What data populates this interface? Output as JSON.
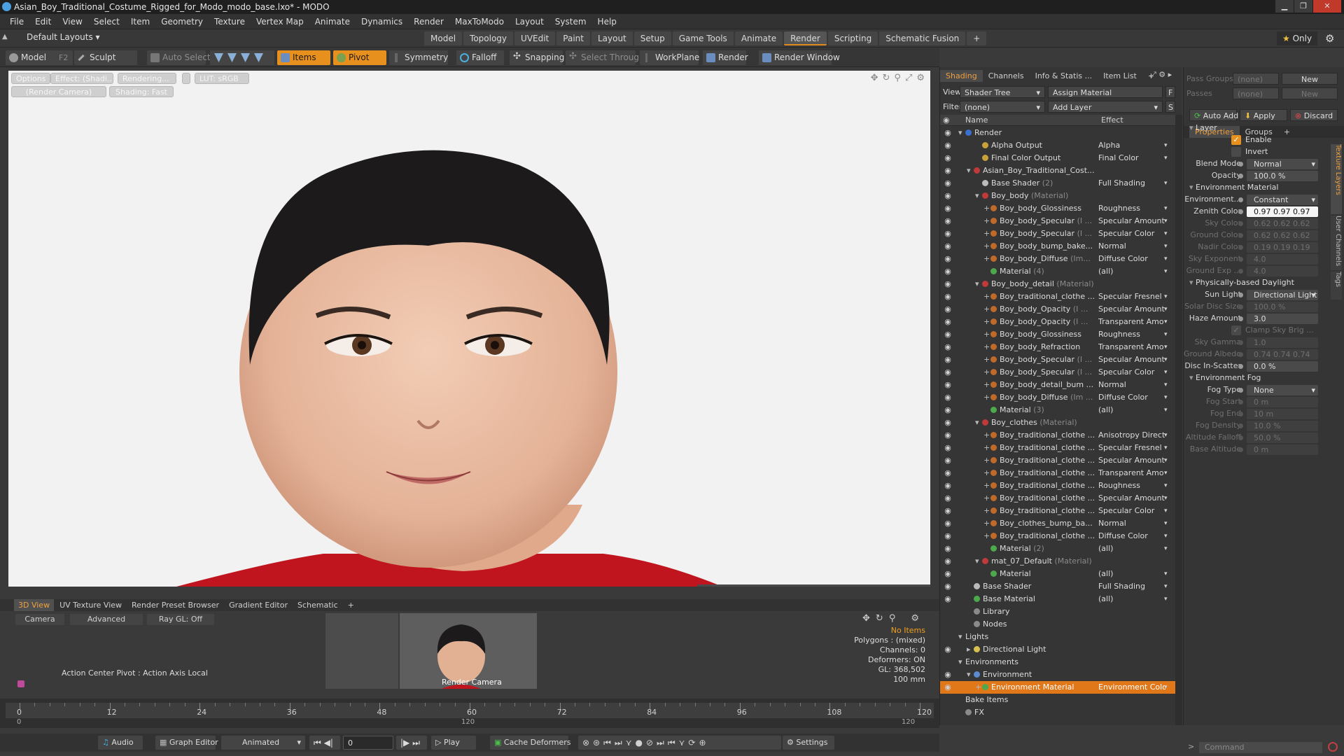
{
  "window": {
    "title": "Asian_Boy_Traditional_Costume_Rigged_for_Modo_modo_base.lxo* - MODO"
  },
  "menu": [
    "File",
    "Edit",
    "View",
    "Select",
    "Item",
    "Geometry",
    "Texture",
    "Vertex Map",
    "Animate",
    "Dynamics",
    "Render",
    "MaxToModo",
    "Layout",
    "System",
    "Help"
  ],
  "layout": {
    "selector": "Default Layouts ▾",
    "only": "Only",
    "tabs": [
      "Model",
      "Topology",
      "UVEdit",
      "Paint",
      "Layout",
      "Setup",
      "Game Tools",
      "Animate",
      "Render",
      "Scripting",
      "Schematic Fusion",
      "+"
    ],
    "active_tab": "Render"
  },
  "toolbar": {
    "model": "Model",
    "f2": "F2",
    "sculpt": "Sculpt",
    "auto_select": "Auto Select",
    "items": "Items",
    "pivot": "Pivot",
    "symmetry": "Symmetry",
    "falloff": "Falloff",
    "snapping": "Snapping",
    "select_through": "Select Through",
    "workplane": "WorkPlane",
    "render": "Render",
    "render_window": "Render Window"
  },
  "viewport": {
    "chips": [
      "Options",
      "Effect: (Shadi...",
      "Rendering...",
      "LUT: sRGB",
      "(Render Camera)",
      "Shading: Fast"
    ]
  },
  "bottom_tabs": [
    "3D View",
    "UV Texture View",
    "Render Preset Browser",
    "Gradient Editor",
    "Schematic",
    "+"
  ],
  "bottom": {
    "camera": "Camera",
    "advanced": "Advanced",
    "raygl": "Ray GL: Off",
    "action_center": "Action Center Pivot : Action Axis Local",
    "render_camera": "Render Camera",
    "status": [
      "No Items",
      "Polygons : (mixed)",
      "Channels: 0",
      "Deformers: ON",
      "GL: 368,502",
      "100 mm"
    ]
  },
  "timeline": {
    "ticks": [
      "0",
      "12",
      "24",
      "36",
      "48",
      "60",
      "72",
      "84",
      "96",
      "108",
      "120"
    ],
    "sub_ticks": [
      "0",
      "120"
    ]
  },
  "playbar": {
    "audio": "Audio",
    "graph_editor": "Graph Editor",
    "animated": "Animated",
    "frame": "0",
    "play": "Play",
    "cache": "Cache Deformers",
    "settings": "Settings"
  },
  "shading": {
    "tabs": [
      "Shading",
      "Channels",
      "Info & Statis ...",
      "Item List",
      "+"
    ],
    "view_label": "View",
    "view_value": "Shader Tree",
    "assign": "Assign Material",
    "f_btn": "F",
    "filter_label": "Filter",
    "filter_value": "(none)",
    "add_layer": "Add Layer",
    "s_btn": "S",
    "col_name": "Name",
    "col_effect": "Effect",
    "rows": [
      {
        "n": "Render",
        "s": "",
        "e": "",
        "i": 0,
        "c": "#3b6fd0",
        "t": "▾"
      },
      {
        "n": "Alpha Output",
        "s": "",
        "e": "Alpha",
        "i": 2,
        "c": "#c9a13a",
        "t": ""
      },
      {
        "n": "Final Color Output",
        "s": "",
        "e": "Final Color",
        "i": 2,
        "c": "#c9a13a",
        "t": ""
      },
      {
        "n": "Asian_Boy_Traditional_Cost...",
        "s": "",
        "e": "",
        "i": 1,
        "c": "#c03a3a",
        "t": "▾"
      },
      {
        "n": "Base Shader",
        "s": "(2)",
        "e": "Full Shading",
        "i": 2,
        "c": "#bbbbbb",
        "t": ""
      },
      {
        "n": "Boy_body",
        "s": "(Material)",
        "e": "",
        "i": 2,
        "c": "#c03a3a",
        "t": "▾"
      },
      {
        "n": "Boy_body_Glossiness",
        "s": "",
        "e": "Roughness",
        "i": 3,
        "c": "#c06a2a",
        "t": "+"
      },
      {
        "n": "Boy_body_Specular",
        "s": "(I ...",
        "e": "Specular Amount",
        "i": 3,
        "c": "#c06a2a",
        "t": "+"
      },
      {
        "n": "Boy_body_Specular",
        "s": "(I ...",
        "e": "Specular Color",
        "i": 3,
        "c": "#c06a2a",
        "t": "+"
      },
      {
        "n": "Boy_body_bump_bake...",
        "s": "",
        "e": "Normal",
        "i": 3,
        "c": "#c06a2a",
        "t": "+"
      },
      {
        "n": "Boy_body_Diffuse",
        "s": "(Im...",
        "e": "Diffuse Color",
        "i": 3,
        "c": "#c06a2a",
        "t": "+"
      },
      {
        "n": "Material",
        "s": "(4)",
        "e": "(all)",
        "i": 3,
        "c": "#4caa4c",
        "t": ""
      },
      {
        "n": "Boy_body_detail",
        "s": "(Material)",
        "e": "",
        "i": 2,
        "c": "#c03a3a",
        "t": "▾"
      },
      {
        "n": "Boy_traditional_clothe ...",
        "s": "",
        "e": "Specular Fresnel",
        "i": 3,
        "c": "#c06a2a",
        "t": "+"
      },
      {
        "n": "Boy_body_Opacity",
        "s": "(I ...",
        "e": "Specular Amount",
        "i": 3,
        "c": "#c06a2a",
        "t": "+"
      },
      {
        "n": "Boy_body_Opacity",
        "s": "(I ...",
        "e": "Transparent Amo ...",
        "i": 3,
        "c": "#c06a2a",
        "t": "+"
      },
      {
        "n": "Boy_body_Glossiness",
        "s": "",
        "e": "Roughness",
        "i": 3,
        "c": "#c06a2a",
        "t": "+"
      },
      {
        "n": "Boy_body_Refraction",
        "s": "",
        "e": "Transparent Amo ...",
        "i": 3,
        "c": "#c06a2a",
        "t": "+"
      },
      {
        "n": "Boy_body_Specular",
        "s": "(I ...",
        "e": "Specular Amount",
        "i": 3,
        "c": "#c06a2a",
        "t": "+"
      },
      {
        "n": "Boy_body_Specular",
        "s": "(I ...",
        "e": "Specular Color",
        "i": 3,
        "c": "#c06a2a",
        "t": "+"
      },
      {
        "n": "Boy_body_detail_bum ...",
        "s": "",
        "e": "Normal",
        "i": 3,
        "c": "#c06a2a",
        "t": "+"
      },
      {
        "n": "Boy_body_Diffuse",
        "s": "(Im ...",
        "e": "Diffuse Color",
        "i": 3,
        "c": "#c06a2a",
        "t": "+"
      },
      {
        "n": "Material",
        "s": "(3)",
        "e": "(all)",
        "i": 3,
        "c": "#4caa4c",
        "t": ""
      },
      {
        "n": "Boy_clothes",
        "s": "(Material)",
        "e": "",
        "i": 2,
        "c": "#c03a3a",
        "t": "▾"
      },
      {
        "n": "Boy_traditional_clothe ...",
        "s": "",
        "e": "Anisotropy Direct...",
        "i": 3,
        "c": "#c06a2a",
        "t": "+"
      },
      {
        "n": "Boy_traditional_clothe ...",
        "s": "",
        "e": "Specular Fresnel",
        "i": 3,
        "c": "#c06a2a",
        "t": "+"
      },
      {
        "n": "Boy_traditional_clothe ...",
        "s": "",
        "e": "Specular Amount",
        "i": 3,
        "c": "#c06a2a",
        "t": "+"
      },
      {
        "n": "Boy_traditional_clothe ...",
        "s": "",
        "e": "Transparent Amo ...",
        "i": 3,
        "c": "#c06a2a",
        "t": "+"
      },
      {
        "n": "Boy_traditional_clothe ...",
        "s": "",
        "e": "Roughness",
        "i": 3,
        "c": "#c06a2a",
        "t": "+"
      },
      {
        "n": "Boy_traditional_clothe ...",
        "s": "",
        "e": "Specular Amount",
        "i": 3,
        "c": "#c06a2a",
        "t": "+"
      },
      {
        "n": "Boy_traditional_clothe ...",
        "s": "",
        "e": "Specular Color",
        "i": 3,
        "c": "#c06a2a",
        "t": "+"
      },
      {
        "n": "Boy_clothes_bump_ba...",
        "s": "",
        "e": "Normal",
        "i": 3,
        "c": "#c06a2a",
        "t": "+"
      },
      {
        "n": "Boy_traditional_clothe ...",
        "s": "",
        "e": "Diffuse Color",
        "i": 3,
        "c": "#c06a2a",
        "t": "+"
      },
      {
        "n": "Material",
        "s": "(2)",
        "e": "(all)",
        "i": 3,
        "c": "#4caa4c",
        "t": ""
      },
      {
        "n": "mat_07_Default",
        "s": "(Material)",
        "e": "",
        "i": 2,
        "c": "#c03a3a",
        "t": "▾"
      },
      {
        "n": "Material",
        "s": "",
        "e": "(all)",
        "i": 3,
        "c": "#4caa4c",
        "t": ""
      },
      {
        "n": "Base Shader",
        "s": "",
        "e": "Full Shading",
        "i": 1,
        "c": "#bbbbbb",
        "t": ""
      },
      {
        "n": "Base Material",
        "s": "",
        "e": "(all)",
        "i": 1,
        "c": "#4caa4c",
        "t": ""
      },
      {
        "n": "Library",
        "s": "",
        "e": "",
        "i": 1,
        "c": "#8a8a8a",
        "t": ""
      },
      {
        "n": "Nodes",
        "s": "",
        "e": "",
        "i": 1,
        "c": "#8a8a8a",
        "t": ""
      },
      {
        "n": "Lights",
        "s": "",
        "e": "",
        "i": 0,
        "c": "",
        "t": "▾"
      },
      {
        "n": "Directional Light",
        "s": "",
        "e": "",
        "i": 1,
        "c": "#d8c050",
        "t": "▸"
      },
      {
        "n": "Environments",
        "s": "",
        "e": "",
        "i": 0,
        "c": "",
        "t": "▾"
      },
      {
        "n": "Environment",
        "s": "",
        "e": "",
        "i": 1,
        "c": "#5a8ad0",
        "t": "▾"
      },
      {
        "n": "Environment Material",
        "s": "",
        "e": "Environment Color",
        "i": 2,
        "c": "#4caa4c",
        "t": "+"
      },
      {
        "n": "Bake Items",
        "s": "",
        "e": "",
        "i": 0,
        "c": "",
        "t": ""
      },
      {
        "n": "FX",
        "s": "",
        "e": "",
        "i": 0,
        "c": "#8a8a8a",
        "t": ""
      }
    ],
    "selected_index": 44
  },
  "props": {
    "pass_groups": "Pass Groups",
    "pass_groups_val": "(none)",
    "new1": "New",
    "passes": "Passes",
    "passes_val": "(none)",
    "new2": "New",
    "auto_add": "Auto Add",
    "apply": "Apply",
    "discard": "Discard",
    "tabs": [
      "Properties",
      "Groups",
      "+"
    ],
    "side_tabs": [
      "Texture Layers",
      "User Channels",
      "Tags"
    ],
    "sec_layer": "Layer",
    "enable": "Enable",
    "invert": "Invert",
    "blend_mode": "Blend Mode",
    "blend_mode_val": "Normal",
    "opacity": "Opacity",
    "opacity_val": "100.0 %",
    "sec_env": "Environment Material",
    "environment": "Environment...",
    "environment_val": "Constant",
    "zenith": "Zenith Color",
    "zenith_val": "0.97  0.97  0.97",
    "sky": "Sky Color",
    "sky_val": "0.62  0.62  0.62",
    "ground": "Ground Color",
    "ground_val": "0.62  0.62  0.62",
    "nadir": "Nadir Color",
    "nadir_val": "0.19  0.19  0.19",
    "sky_exp": "Sky Exponent",
    "sky_exp_val": "4.0",
    "ground_exp": "Ground Exp ...",
    "ground_exp_val": "4.0",
    "sec_daylight": "Physically-based Daylight",
    "sun_light": "Sun Light",
    "sun_light_val": "Directional Light",
    "solar": "Solar Disc Size",
    "solar_val": "100.0 %",
    "haze": "Haze Amount",
    "haze_val": "3.0",
    "clamp": "Clamp Sky Brig ...",
    "sky_gamma": "Sky Gamma",
    "sky_gamma_val": "1.0",
    "albedo": "Ground Albedo",
    "albedo_val": "0.74  0.74  0.74",
    "disc": "Disc In-Scatter",
    "disc_val": "0.0 %",
    "sec_fog": "Environment Fog",
    "fog_type": "Fog Type",
    "fog_type_val": "None",
    "fog_start": "Fog Start",
    "fog_start_val": "0 m",
    "fog_end": "Fog End",
    "fog_end_val": "10 m",
    "fog_density": "Fog Density",
    "fog_density_val": "10.0 %",
    "alt_falloff": "Altitude Falloff",
    "alt_falloff_val": "50.0 %",
    "base_alt": "Base Altitude",
    "base_alt_val": "0 m",
    "command": "Command"
  }
}
